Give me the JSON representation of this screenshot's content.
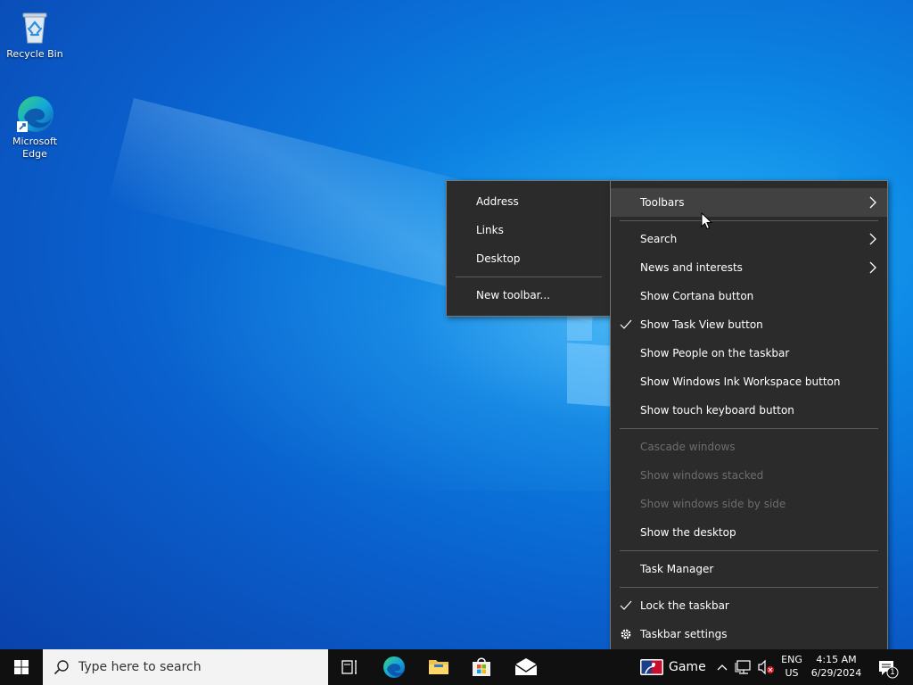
{
  "desktop": {
    "icons": [
      {
        "label": "Recycle Bin"
      },
      {
        "label": "Microsoft Edge"
      }
    ]
  },
  "toolbars_submenu": {
    "items": [
      {
        "label": "Address"
      },
      {
        "label": "Links"
      },
      {
        "label": "Desktop"
      },
      {
        "label": "New toolbar..."
      }
    ]
  },
  "taskbar_menu": {
    "toolbars": "Toolbars",
    "search": "Search",
    "news": "News and interests",
    "cortana": "Show Cortana button",
    "task_view": "Show Task View button",
    "people": "Show People on the taskbar",
    "ink": "Show Windows Ink Workspace button",
    "touch_keyboard": "Show touch keyboard button",
    "cascade": "Cascade windows",
    "stacked": "Show windows stacked",
    "side_by_side": "Show windows side by side",
    "show_desktop": "Show the desktop",
    "task_manager": "Task Manager",
    "lock": "Lock the taskbar",
    "settings": "Taskbar settings"
  },
  "taskbar": {
    "search_placeholder": "Type here to search",
    "news_label": "Game",
    "lang_top": "ENG",
    "lang_bottom": "US",
    "time": "4:15 AM",
    "date": "6/29/2024",
    "notification_count": "1"
  },
  "colors": {
    "menu_bg": "#2b2b2b",
    "menu_hover": "#414141",
    "taskbar_bg": "#101010",
    "disabled_text": "#6d6d6d"
  }
}
